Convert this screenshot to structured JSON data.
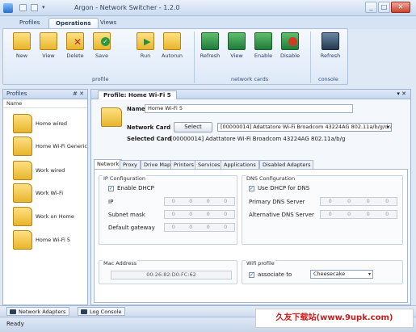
{
  "window": {
    "title": "Argon - Network Switcher - 1.2.0",
    "min": "_",
    "max": "□",
    "close": "✕"
  },
  "ribbon": {
    "tabs": [
      "Profiles",
      "Operations",
      "Views"
    ],
    "active_tab": "Operations",
    "profile_buttons": [
      "New",
      "View",
      "Delete",
      "Save",
      "Run",
      "Autorun"
    ],
    "profile_group": "profile",
    "card_buttons": [
      "Refresh",
      "View",
      "Enable",
      "Disable"
    ],
    "card_group": "network cards",
    "console_buttons": [
      "Refresh"
    ],
    "console_group": "console"
  },
  "profiles_panel": {
    "title": "Profiles",
    "pin": "# ✕",
    "column": "Name",
    "items": [
      "Home wired",
      "Home Wi-Fi Generic",
      "Work wired",
      "Work Wi-Fi",
      "Work on Home",
      "Home Wi-Fi 5"
    ]
  },
  "profile": {
    "tab_title": "Profile: Home Wi-Fi 5",
    "tab_controls": "▾ ✕",
    "name_label": "Name",
    "name_value": "Home Wi-Fi 5",
    "card_label": "Network Card",
    "select_button": "Select",
    "card_value": "[00000014] Adattatore Wi-Fi Broadcom 43224AG 802.11a/b/g/draft-n",
    "selected_label": "Selected Card",
    "selected_value": "[00000014] Adattatore Wi-Fi Broadcom 43224AG 802.11a/b/g/draft-n"
  },
  "tabs": [
    "Network",
    "Proxy",
    "Drive Map",
    "Printers",
    "Services",
    "Applications",
    "Disabled Adapters"
  ],
  "active_tab": "Network",
  "ip": {
    "title": "IP Configuration",
    "dhcp": "Enable DHCP",
    "ip": "IP",
    "mask": "Subnet mask",
    "gateway": "Default gateway",
    "octet": "0"
  },
  "dns": {
    "title": "DNS Configuration",
    "dhcp": "Use DHCP for DNS",
    "primary": "Primary DNS Server",
    "alternative": "Alternative DNS Server"
  },
  "mac": {
    "title": "Mac Address",
    "value": "00:26:82:D0:FC:62"
  },
  "wifi": {
    "title": "Wifi profile",
    "assoc": "associate to",
    "profile": "Cheesecake"
  },
  "bottom_tabs": [
    "Network Adapters",
    "Log Console"
  ],
  "status": "Ready",
  "watermark": "久友下载站(www.9upk.com)"
}
